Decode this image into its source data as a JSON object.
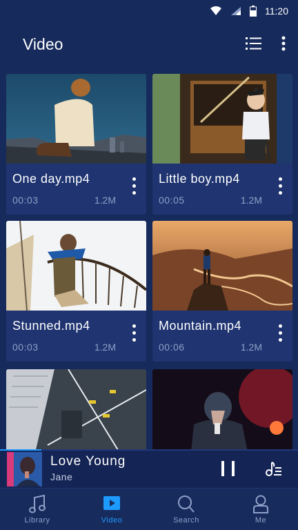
{
  "status_bar": {
    "time": "11:20"
  },
  "app_bar": {
    "title": "Video"
  },
  "videos": [
    {
      "name": "One day.mp4",
      "duration": "00:03",
      "size": "1.2M"
    },
    {
      "name": "Little boy.mp4",
      "duration": "00:05",
      "size": "1.2M"
    },
    {
      "name": "Stunned.mp4",
      "duration": "00:03",
      "size": "1.2M"
    },
    {
      "name": "Mountain.mp4",
      "duration": "00:06",
      "size": "1.2M"
    },
    {
      "name": "",
      "duration": "",
      "size": ""
    },
    {
      "name": "",
      "duration": "",
      "size": ""
    }
  ],
  "player": {
    "song": "Love Young",
    "artist": "Jane",
    "progress": 0.14
  },
  "nav": [
    {
      "label": "Library",
      "icon": "music-note-icon",
      "active": false
    },
    {
      "label": "Video",
      "icon": "video-play-icon",
      "active": true
    },
    {
      "label": "Search",
      "icon": "search-icon",
      "active": false
    },
    {
      "label": "Me",
      "icon": "person-icon",
      "active": false
    }
  ],
  "colors": {
    "background": "#172a5c",
    "card": "#1f3470",
    "accent": "#1e9bff",
    "secondary_text": "#8fa0c8"
  }
}
